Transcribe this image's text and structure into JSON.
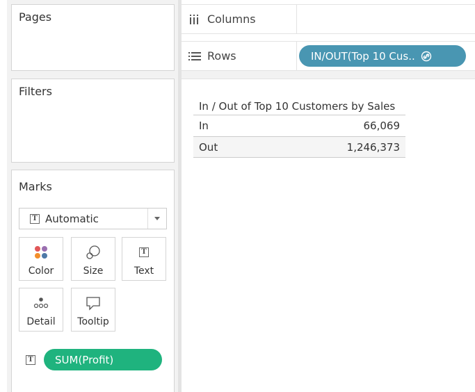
{
  "cards": {
    "pages": {
      "title": "Pages"
    },
    "filters": {
      "title": "Filters"
    },
    "marks": {
      "title": "Marks",
      "mark_type": "Automatic",
      "buttons": {
        "color": "Color",
        "size": "Size",
        "text": "Text",
        "detail": "Detail",
        "tooltip": "Tooltip"
      },
      "fields": [
        {
          "label": "SUM(Profit)",
          "encoding": "text",
          "color": "#1fb37e"
        }
      ]
    }
  },
  "shelves": {
    "columns": {
      "label": "Columns",
      "icon": "columns-icon"
    },
    "rows": {
      "label": "Rows",
      "icon": "rows-icon",
      "pill": {
        "label": "IN/OUT(Top 10 Cus..",
        "icon": "link-icon",
        "color": "#4996b2"
      }
    }
  },
  "view": {
    "header": "In / Out of Top 10 Customers by Sales",
    "rows": [
      {
        "label": "In",
        "value": "66,069"
      },
      {
        "label": "Out",
        "value": "1,246,373"
      }
    ]
  }
}
